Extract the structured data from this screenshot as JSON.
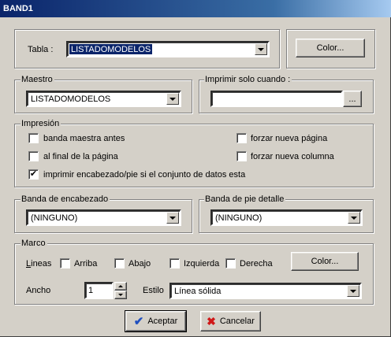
{
  "window": {
    "title": "BAND1"
  },
  "top": {
    "tabla_label": "Tabla :",
    "tabla_value": "LISTADOMODELOS",
    "color_button": "Color..."
  },
  "maestro": {
    "legend": "Maestro",
    "value": "LISTADOMODELOS"
  },
  "imprimir": {
    "legend": "Imprimir solo cuando :",
    "value": "",
    "browse_button": "..."
  },
  "impresion": {
    "legend": "Impresión",
    "options": [
      {
        "label": "banda maestra antes",
        "checked": false
      },
      {
        "label": "al final de la página",
        "checked": false
      },
      {
        "label": "imprimir encabezado/pie si el conjunto de datos esta",
        "checked": true
      },
      {
        "label": "forzar nueva página",
        "checked": false
      },
      {
        "label": "forzar nueva columna",
        "checked": false
      }
    ]
  },
  "encabezado": {
    "legend": "Banda de encabezado",
    "value": "(NINGUNO)"
  },
  "pie": {
    "legend": "Banda de pie detalle",
    "value": "(NINGUNO)"
  },
  "marco": {
    "legend": "Marco",
    "lineas_label": "Lineas",
    "lines": [
      {
        "label": "Arriba",
        "checked": false
      },
      {
        "label": "Abajo",
        "checked": false
      },
      {
        "label": "Izquierda",
        "checked": false
      },
      {
        "label": "Derecha",
        "checked": false
      }
    ],
    "color_button": "Color...",
    "ancho_label": "Ancho",
    "ancho_value": "1",
    "estilo_label": "Estilo",
    "estilo_value": "Línea sólida"
  },
  "buttons": {
    "ok": "Aceptar",
    "cancel": "Cancelar"
  },
  "colors": {
    "titlebar": "#0a246a",
    "face": "#d4d0c8",
    "ok_check": "#1f4fbf",
    "cancel_x": "#d01818"
  }
}
